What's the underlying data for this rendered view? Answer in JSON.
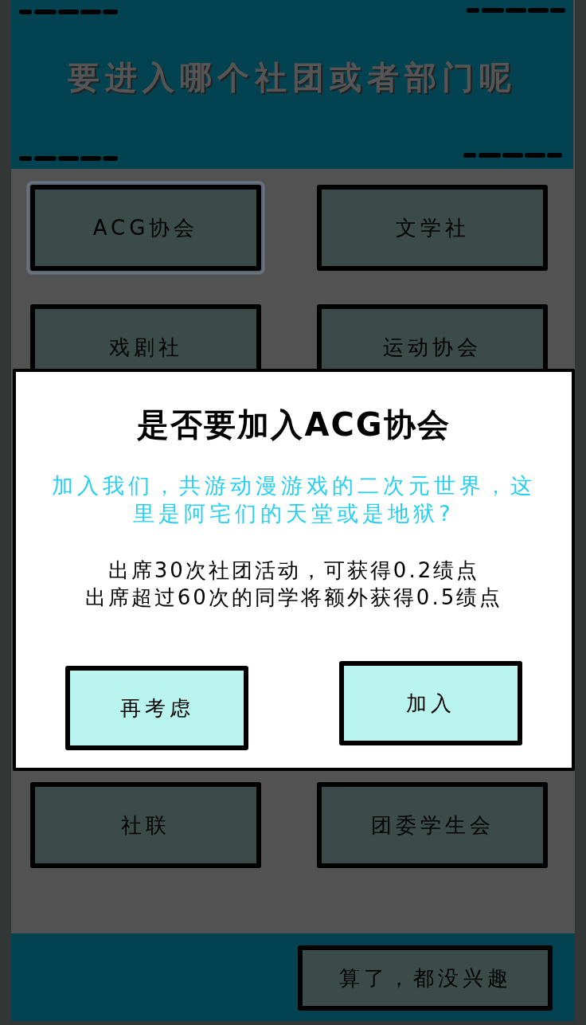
{
  "header": {
    "title": "要进入哪个社团或者部门呢"
  },
  "clubs": [
    {
      "label": "ACG协会",
      "selected": true
    },
    {
      "label": "文学社",
      "selected": false
    },
    {
      "label": "戏剧社",
      "selected": false
    },
    {
      "label": "运动协会",
      "selected": false
    },
    {
      "label": "社联",
      "selected": false
    },
    {
      "label": "团委学生会",
      "selected": false
    }
  ],
  "dismiss_button": {
    "label": "算了，都没兴趣"
  },
  "dialog": {
    "title": "是否要加入ACG协会",
    "description": "加入我们，共游动漫游戏的二次元世界，这里是阿宅们的天堂或是地狱?",
    "details": [
      "出席30次社团活动，可获得0.2绩点",
      "出席超过60次的同学将额外获得0.5绩点"
    ],
    "buttons": [
      {
        "label": "再考虑"
      },
      {
        "label": "加入"
      }
    ]
  }
}
